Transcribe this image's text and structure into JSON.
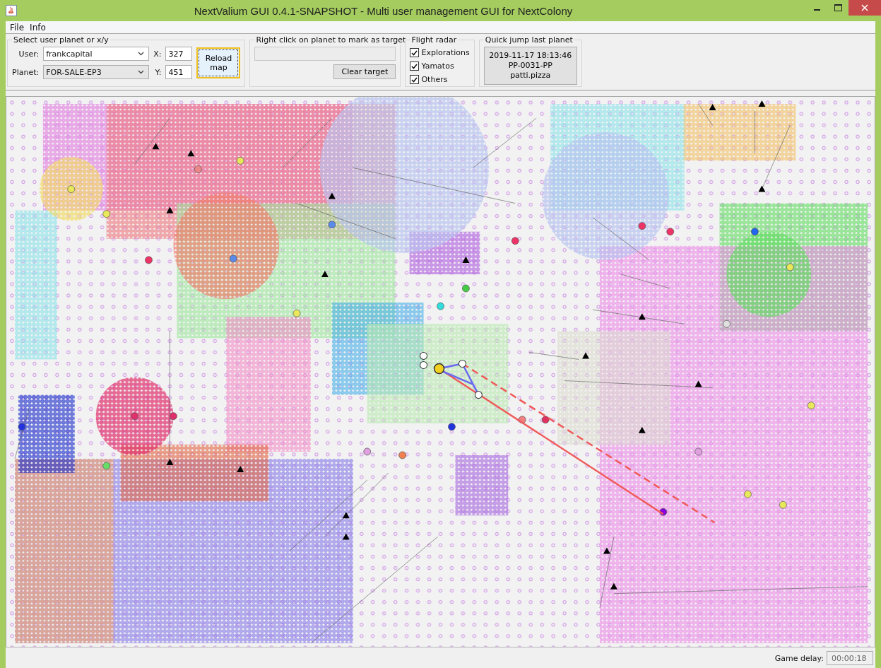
{
  "window": {
    "title": "NextValium GUI 0.4.1-SNAPSHOT - Multi user management GUI for NextColony"
  },
  "menu": [
    "File",
    "Info"
  ],
  "select_panel": {
    "title": "Select user planet or x/y",
    "user_label": "User:",
    "user_value": "frankcapital",
    "planet_label": "Planet:",
    "planet_value": "FOR-SALE-EP3",
    "x_label": "X:",
    "x_value": "327",
    "y_label": "Y:",
    "y_value": "451",
    "reload_button": "Reload map"
  },
  "target_panel": {
    "title": "Right click on planet to mark as target",
    "clear_button": "Clear target"
  },
  "flight_radar": {
    "title": "Flight radar",
    "options": [
      {
        "label": "Explorations",
        "checked": true
      },
      {
        "label": "Yamatos",
        "checked": true
      },
      {
        "label": "Others",
        "checked": true
      }
    ]
  },
  "quick_jump": {
    "title": "Quick jump last planet",
    "lines": [
      "2019-11-17 18:13:46",
      "PP-0031-PP",
      "patti.pizza"
    ]
  },
  "status_bar": {
    "label": "Game delay:",
    "value": "00:00:18"
  }
}
